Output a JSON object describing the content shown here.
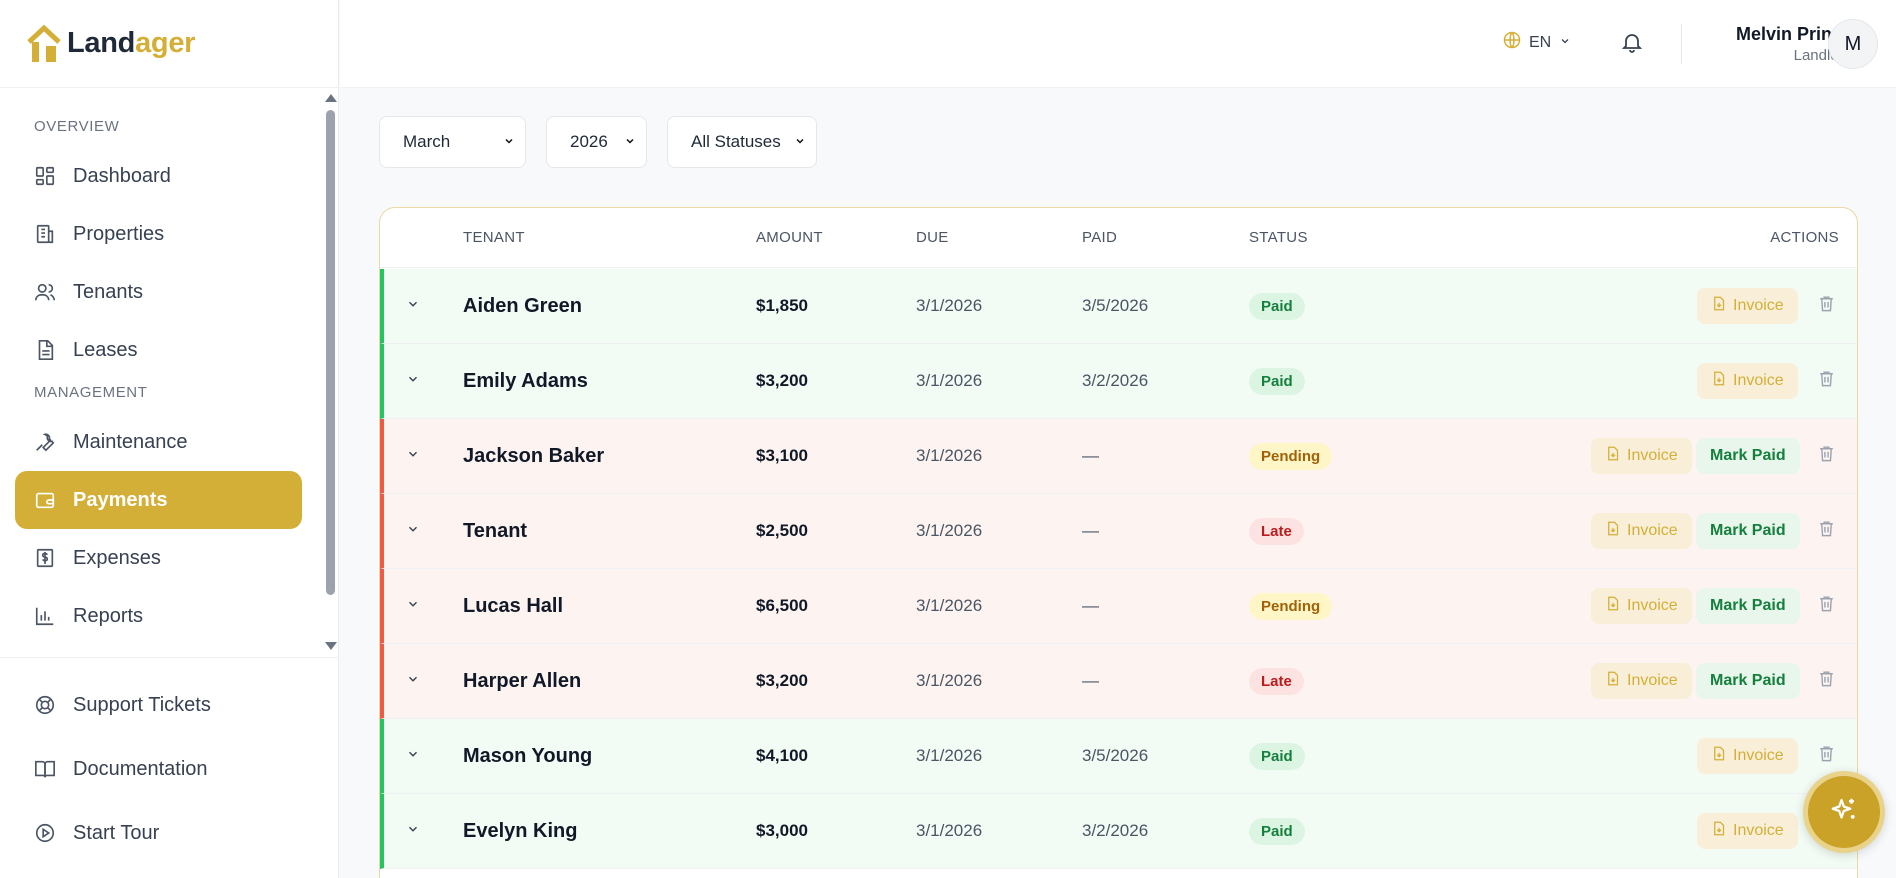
{
  "app": {
    "name_part1": "Land",
    "name_part2": "ager",
    "brand_color": "#d4af37"
  },
  "sidebar": {
    "sections": [
      {
        "label": "OVERVIEW",
        "items": [
          {
            "label": "Dashboard",
            "icon": "dashboard-icon"
          },
          {
            "label": "Properties",
            "icon": "building-icon"
          },
          {
            "label": "Tenants",
            "icon": "users-icon"
          },
          {
            "label": "Leases",
            "icon": "document-icon"
          }
        ]
      },
      {
        "label": "MANAGEMENT",
        "items": [
          {
            "label": "Maintenance",
            "icon": "wrench-icon"
          },
          {
            "label": "Payments",
            "icon": "wallet-icon",
            "active": true
          },
          {
            "label": "Expenses",
            "icon": "receipt-icon"
          },
          {
            "label": "Reports",
            "icon": "bar-chart-icon"
          }
        ]
      }
    ],
    "bottom": [
      {
        "label": "Support Tickets",
        "icon": "lifebuoy-icon"
      },
      {
        "label": "Documentation",
        "icon": "book-icon"
      },
      {
        "label": "Start Tour",
        "icon": "play-circle-icon"
      }
    ]
  },
  "header": {
    "language": "EN",
    "user_name": "Melvin Prince",
    "user_role": "Landlord",
    "avatar_initial": "M"
  },
  "filters": {
    "month": "March",
    "year": "2026",
    "status": "All Statuses"
  },
  "table": {
    "columns": {
      "tenant": "TENANT",
      "amount": "AMOUNT",
      "due": "DUE",
      "paid": "PAID",
      "status": "STATUS",
      "actions": "ACTIONS"
    },
    "invoice_label": "Invoice",
    "mark_paid_label": "Mark Paid",
    "rows": [
      {
        "tenant": "Aiden Green",
        "amount": "$1,850",
        "due": "3/1/2026",
        "paid": "3/5/2026",
        "status": "Paid"
      },
      {
        "tenant": "Emily Adams",
        "amount": "$3,200",
        "due": "3/1/2026",
        "paid": "3/2/2026",
        "status": "Paid"
      },
      {
        "tenant": "Jackson Baker",
        "amount": "$3,100",
        "due": "3/1/2026",
        "paid": "—",
        "status": "Pending"
      },
      {
        "tenant": "Tenant",
        "amount": "$2,500",
        "due": "3/1/2026",
        "paid": "—",
        "status": "Late"
      },
      {
        "tenant": "Lucas Hall",
        "amount": "$6,500",
        "due": "3/1/2026",
        "paid": "—",
        "status": "Pending"
      },
      {
        "tenant": "Harper Allen",
        "amount": "$3,200",
        "due": "3/1/2026",
        "paid": "—",
        "status": "Late"
      },
      {
        "tenant": "Mason Young",
        "amount": "$4,100",
        "due": "3/1/2026",
        "paid": "3/5/2026",
        "status": "Paid"
      },
      {
        "tenant": "Evelyn King",
        "amount": "$3,000",
        "due": "3/1/2026",
        "paid": "3/2/2026",
        "status": "Paid"
      }
    ]
  }
}
